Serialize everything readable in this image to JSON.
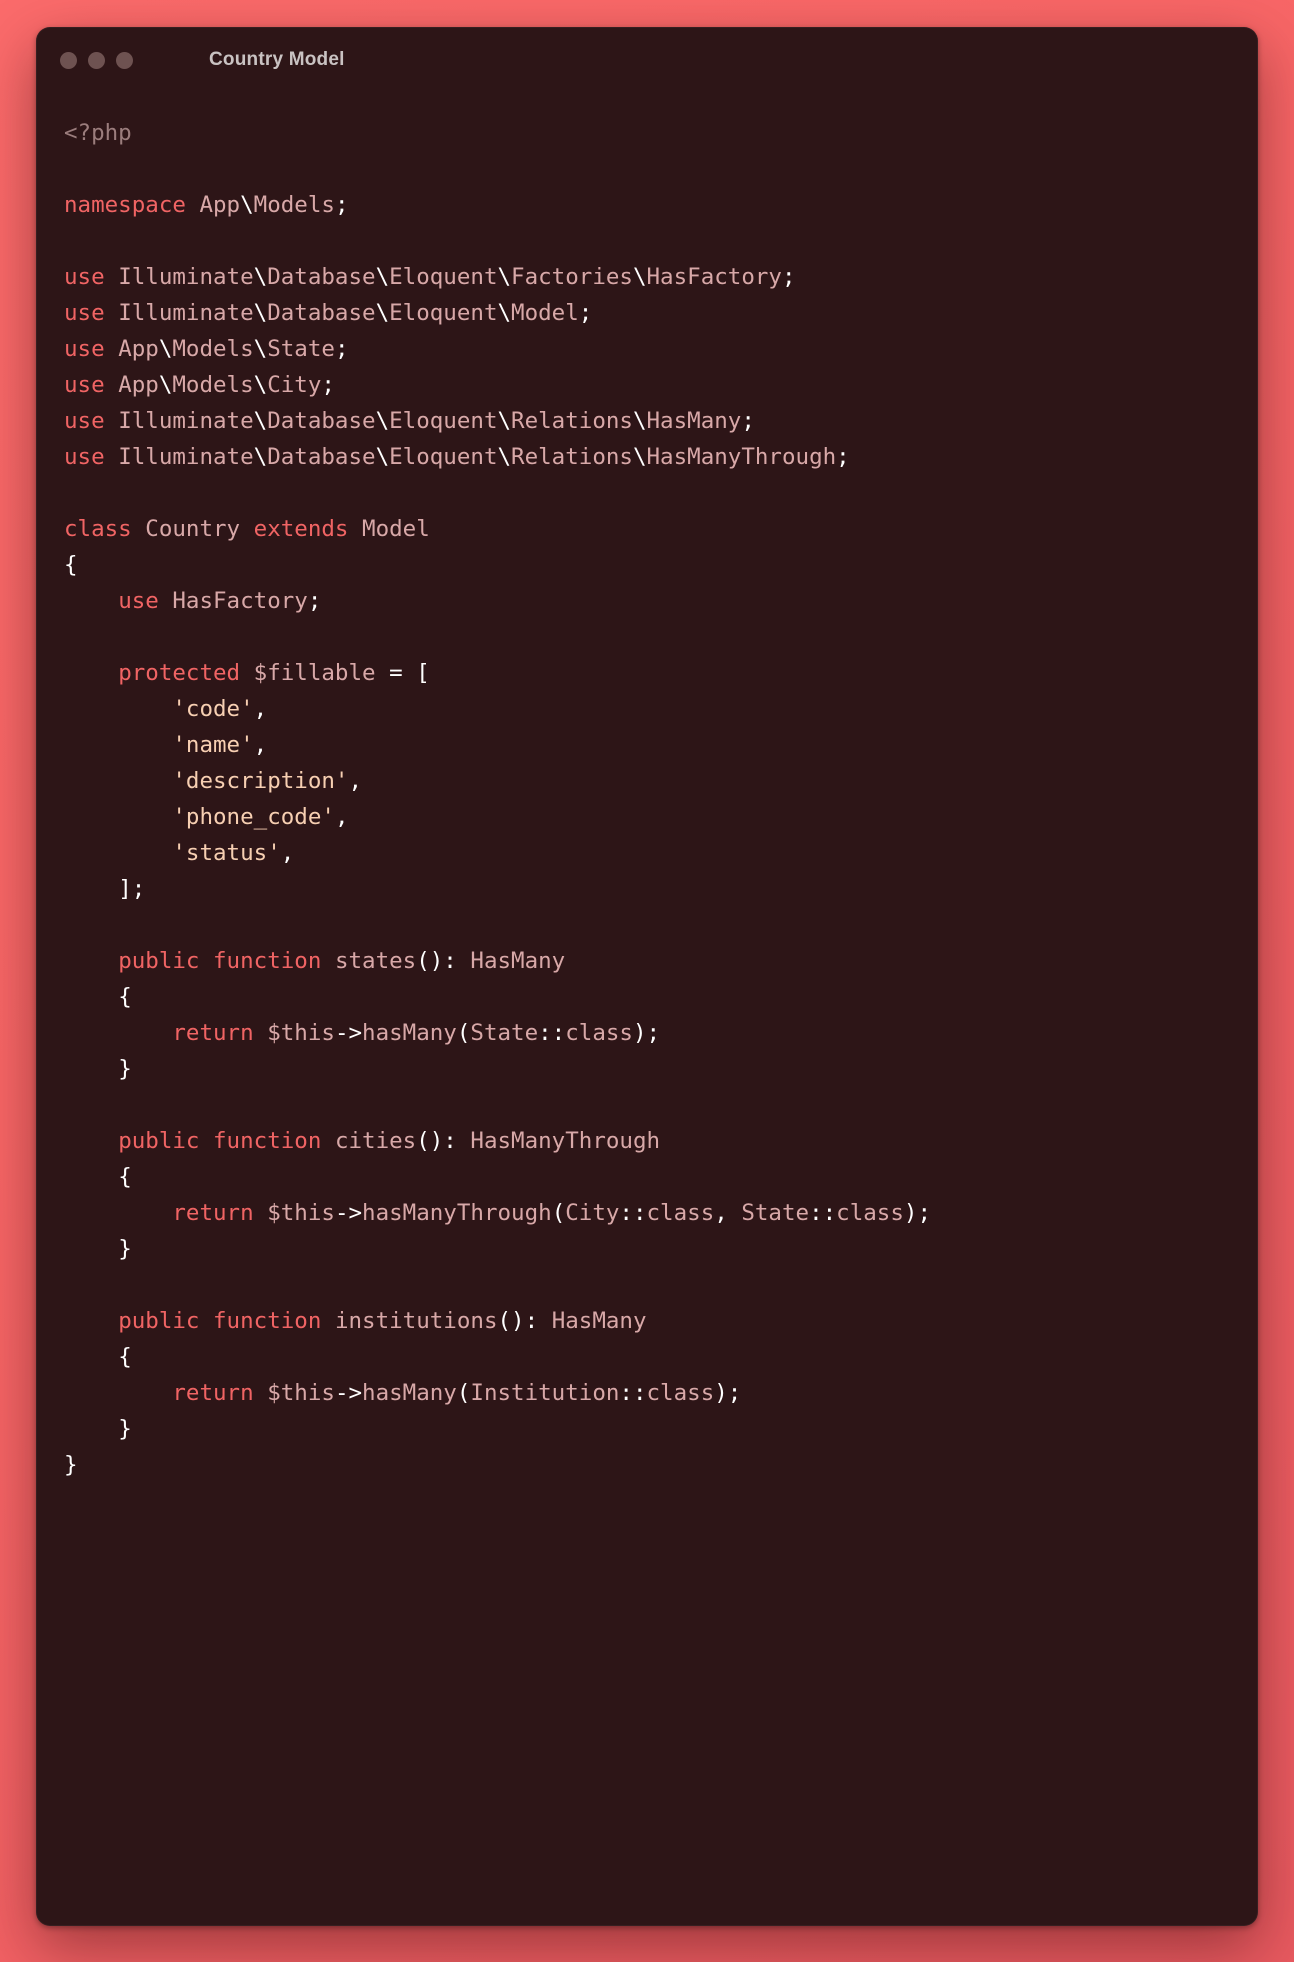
{
  "window": {
    "title": "Country Model",
    "traffic_lights": [
      "close",
      "minimize",
      "zoom"
    ],
    "background_color": "#2d1517",
    "desktop_color": "#fb6b6b"
  },
  "theme": {
    "keyword_color": "#f06464",
    "identifier_color": "#d8a8a8",
    "string_color": "#f7cfb2",
    "punctuation_color": "#ffffff",
    "comment_color": "#9b7d7d"
  },
  "code": {
    "language": "php",
    "lines": [
      "<?php",
      "",
      "namespace App\\Models;",
      "",
      "use Illuminate\\Database\\Eloquent\\Factories\\HasFactory;",
      "use Illuminate\\Database\\Eloquent\\Model;",
      "use App\\Models\\State;",
      "use App\\Models\\City;",
      "use Illuminate\\Database\\Eloquent\\Relations\\HasMany;",
      "use Illuminate\\Database\\Eloquent\\Relations\\HasManyThrough;",
      "",
      "class Country extends Model",
      "{",
      "    use HasFactory;",
      "",
      "    protected $fillable = [",
      "        'code',",
      "        'name',",
      "        'description',",
      "        'phone_code',",
      "        'status',",
      "    ];",
      "",
      "    public function states(): HasMany",
      "    {",
      "        return $this->hasMany(State::class);",
      "    }",
      "",
      "    public function cities(): HasManyThrough",
      "    {",
      "        return $this->hasManyThrough(City::class, State::class);",
      "    }",
      "",
      "    public function institutions(): HasMany",
      "    {",
      "        return $this->hasMany(Institution::class);",
      "    }",
      "}"
    ],
    "tokens": [
      [
        [
          "<?php",
          "cmt"
        ]
      ],
      [],
      [
        [
          "namespace",
          "kw"
        ],
        [
          " ",
          "pun"
        ],
        [
          "App",
          "id"
        ],
        [
          "\\",
          "pun"
        ],
        [
          "Models",
          "id"
        ],
        [
          ";",
          "pun"
        ]
      ],
      [],
      [
        [
          "use",
          "kw"
        ],
        [
          " ",
          "pun"
        ],
        [
          "Illuminate",
          "id"
        ],
        [
          "\\",
          "pun"
        ],
        [
          "Database",
          "id"
        ],
        [
          "\\",
          "pun"
        ],
        [
          "Eloquent",
          "id"
        ],
        [
          "\\",
          "pun"
        ],
        [
          "Factories",
          "id"
        ],
        [
          "\\",
          "pun"
        ],
        [
          "HasFactory",
          "id"
        ],
        [
          ";",
          "pun"
        ]
      ],
      [
        [
          "use",
          "kw"
        ],
        [
          " ",
          "pun"
        ],
        [
          "Illuminate",
          "id"
        ],
        [
          "\\",
          "pun"
        ],
        [
          "Database",
          "id"
        ],
        [
          "\\",
          "pun"
        ],
        [
          "Eloquent",
          "id"
        ],
        [
          "\\",
          "pun"
        ],
        [
          "Model",
          "id"
        ],
        [
          ";",
          "pun"
        ]
      ],
      [
        [
          "use",
          "kw"
        ],
        [
          " ",
          "pun"
        ],
        [
          "App",
          "id"
        ],
        [
          "\\",
          "pun"
        ],
        [
          "Models",
          "id"
        ],
        [
          "\\",
          "pun"
        ],
        [
          "State",
          "id"
        ],
        [
          ";",
          "pun"
        ]
      ],
      [
        [
          "use",
          "kw"
        ],
        [
          " ",
          "pun"
        ],
        [
          "App",
          "id"
        ],
        [
          "\\",
          "pun"
        ],
        [
          "Models",
          "id"
        ],
        [
          "\\",
          "pun"
        ],
        [
          "City",
          "id"
        ],
        [
          ";",
          "pun"
        ]
      ],
      [
        [
          "use",
          "kw"
        ],
        [
          " ",
          "pun"
        ],
        [
          "Illuminate",
          "id"
        ],
        [
          "\\",
          "pun"
        ],
        [
          "Database",
          "id"
        ],
        [
          "\\",
          "pun"
        ],
        [
          "Eloquent",
          "id"
        ],
        [
          "\\",
          "pun"
        ],
        [
          "Relations",
          "id"
        ],
        [
          "\\",
          "pun"
        ],
        [
          "HasMany",
          "id"
        ],
        [
          ";",
          "pun"
        ]
      ],
      [
        [
          "use",
          "kw"
        ],
        [
          " ",
          "pun"
        ],
        [
          "Illuminate",
          "id"
        ],
        [
          "\\",
          "pun"
        ],
        [
          "Database",
          "id"
        ],
        [
          "\\",
          "pun"
        ],
        [
          "Eloquent",
          "id"
        ],
        [
          "\\",
          "pun"
        ],
        [
          "Relations",
          "id"
        ],
        [
          "\\",
          "pun"
        ],
        [
          "HasManyThrough",
          "id"
        ],
        [
          ";",
          "pun"
        ]
      ],
      [],
      [
        [
          "class",
          "kw"
        ],
        [
          " ",
          "pun"
        ],
        [
          "Country",
          "id"
        ],
        [
          " ",
          "pun"
        ],
        [
          "extends",
          "kw"
        ],
        [
          " ",
          "pun"
        ],
        [
          "Model",
          "id"
        ]
      ],
      [
        [
          "{",
          "pun"
        ]
      ],
      [
        [
          "    ",
          "pun"
        ],
        [
          "use",
          "kw"
        ],
        [
          " ",
          "pun"
        ],
        [
          "HasFactory",
          "id"
        ],
        [
          ";",
          "pun"
        ]
      ],
      [],
      [
        [
          "    ",
          "pun"
        ],
        [
          "protected",
          "kw"
        ],
        [
          " ",
          "pun"
        ],
        [
          "$fillable",
          "id"
        ],
        [
          " ",
          "pun"
        ],
        [
          "=",
          "pun"
        ],
        [
          " ",
          "pun"
        ],
        [
          "[",
          "pun"
        ]
      ],
      [
        [
          "        ",
          "pun"
        ],
        [
          "'code'",
          "str"
        ],
        [
          ",",
          "pun"
        ]
      ],
      [
        [
          "        ",
          "pun"
        ],
        [
          "'name'",
          "str"
        ],
        [
          ",",
          "pun"
        ]
      ],
      [
        [
          "        ",
          "pun"
        ],
        [
          "'description'",
          "str"
        ],
        [
          ",",
          "pun"
        ]
      ],
      [
        [
          "        ",
          "pun"
        ],
        [
          "'phone_code'",
          "str"
        ],
        [
          ",",
          "pun"
        ]
      ],
      [
        [
          "        ",
          "pun"
        ],
        [
          "'status'",
          "str"
        ],
        [
          ",",
          "pun"
        ]
      ],
      [
        [
          "    ",
          "pun"
        ],
        [
          "];",
          "pun"
        ]
      ],
      [],
      [
        [
          "    ",
          "pun"
        ],
        [
          "public",
          "kw"
        ],
        [
          " ",
          "pun"
        ],
        [
          "function",
          "kw"
        ],
        [
          " ",
          "pun"
        ],
        [
          "states",
          "id"
        ],
        [
          "(): ",
          "pun"
        ],
        [
          "HasMany",
          "id"
        ]
      ],
      [
        [
          "    ",
          "pun"
        ],
        [
          "{",
          "pun"
        ]
      ],
      [
        [
          "        ",
          "pun"
        ],
        [
          "return",
          "kw"
        ],
        [
          " ",
          "pun"
        ],
        [
          "$this",
          "id"
        ],
        [
          "->",
          "pun"
        ],
        [
          "hasMany",
          "id"
        ],
        [
          "(",
          "pun"
        ],
        [
          "State",
          "id"
        ],
        [
          "::",
          "pun"
        ],
        [
          "class",
          "id"
        ],
        [
          ");",
          "pun"
        ]
      ],
      [
        [
          "    ",
          "pun"
        ],
        [
          "}",
          "pun"
        ]
      ],
      [],
      [
        [
          "    ",
          "pun"
        ],
        [
          "public",
          "kw"
        ],
        [
          " ",
          "pun"
        ],
        [
          "function",
          "kw"
        ],
        [
          " ",
          "pun"
        ],
        [
          "cities",
          "id"
        ],
        [
          "(): ",
          "pun"
        ],
        [
          "HasManyThrough",
          "id"
        ]
      ],
      [
        [
          "    ",
          "pun"
        ],
        [
          "{",
          "pun"
        ]
      ],
      [
        [
          "        ",
          "pun"
        ],
        [
          "return",
          "kw"
        ],
        [
          " ",
          "pun"
        ],
        [
          "$this",
          "id"
        ],
        [
          "->",
          "pun"
        ],
        [
          "hasManyThrough",
          "id"
        ],
        [
          "(",
          "pun"
        ],
        [
          "City",
          "id"
        ],
        [
          "::",
          "pun"
        ],
        [
          "class",
          "id"
        ],
        [
          ", ",
          "pun"
        ],
        [
          "State",
          "id"
        ],
        [
          "::",
          "pun"
        ],
        [
          "class",
          "id"
        ],
        [
          ");",
          "pun"
        ]
      ],
      [
        [
          "    ",
          "pun"
        ],
        [
          "}",
          "pun"
        ]
      ],
      [],
      [
        [
          "    ",
          "pun"
        ],
        [
          "public",
          "kw"
        ],
        [
          " ",
          "pun"
        ],
        [
          "function",
          "kw"
        ],
        [
          " ",
          "pun"
        ],
        [
          "institutions",
          "id"
        ],
        [
          "(): ",
          "pun"
        ],
        [
          "HasMany",
          "id"
        ]
      ],
      [
        [
          "    ",
          "pun"
        ],
        [
          "{",
          "pun"
        ]
      ],
      [
        [
          "        ",
          "pun"
        ],
        [
          "return",
          "kw"
        ],
        [
          " ",
          "pun"
        ],
        [
          "$this",
          "id"
        ],
        [
          "->",
          "pun"
        ],
        [
          "hasMany",
          "id"
        ],
        [
          "(",
          "pun"
        ],
        [
          "Institution",
          "id"
        ],
        [
          "::",
          "pun"
        ],
        [
          "class",
          "id"
        ],
        [
          ");",
          "pun"
        ]
      ],
      [
        [
          "    ",
          "pun"
        ],
        [
          "}",
          "pun"
        ]
      ],
      [
        [
          "}",
          "pun"
        ]
      ]
    ]
  }
}
